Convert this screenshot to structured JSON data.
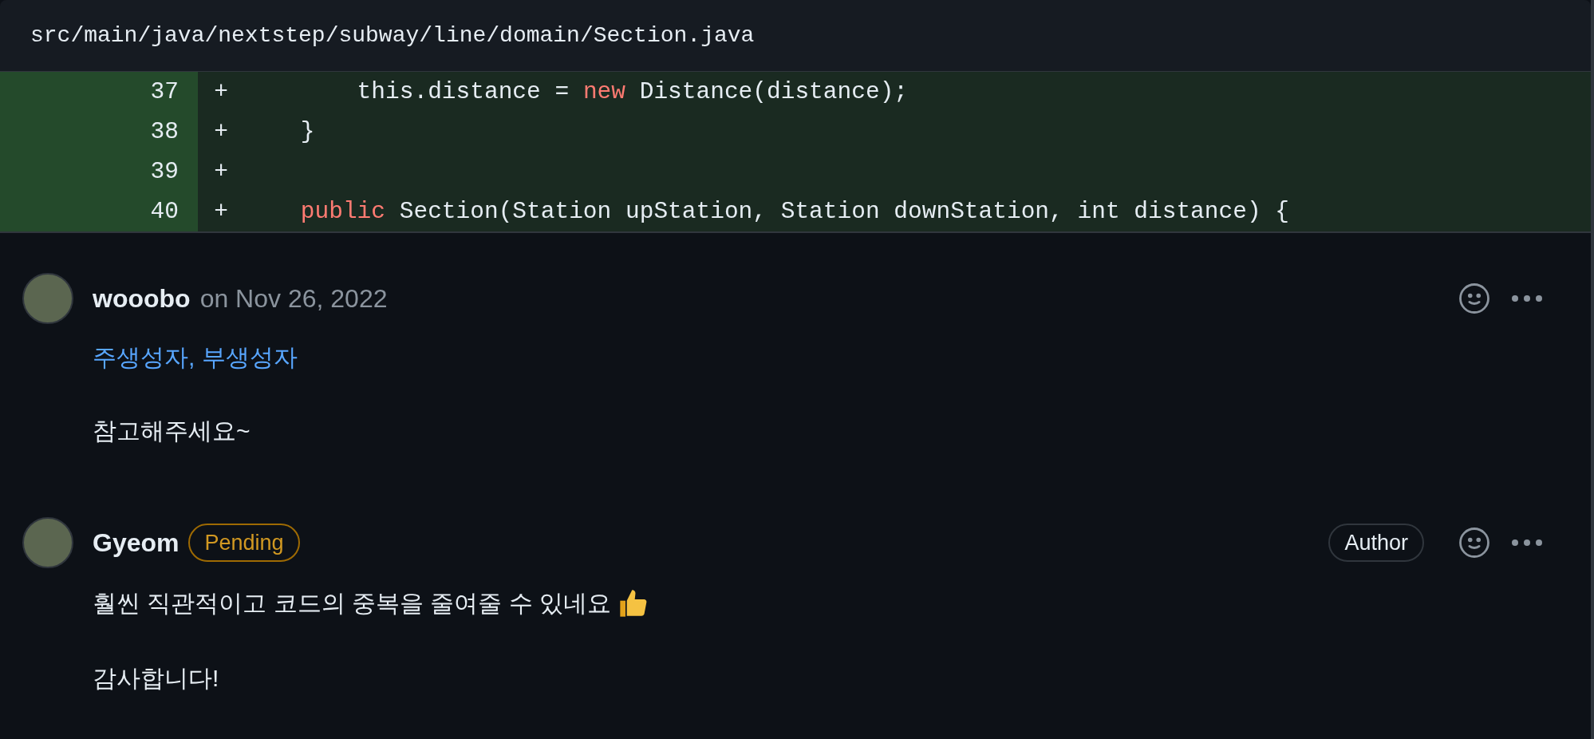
{
  "file_header": {
    "path": "src/main/java/nextstep/subway/line/domain/Section.java"
  },
  "diff_lines": [
    {
      "number": "37",
      "sign": "+",
      "tokens": [
        {
          "kind": "plain",
          "text": "        this.distance = "
        },
        {
          "kind": "keyword",
          "text": "new"
        },
        {
          "kind": "plain",
          "text": " Distance(distance);"
        }
      ]
    },
    {
      "number": "38",
      "sign": "+",
      "tokens": [
        {
          "kind": "plain",
          "text": "    }"
        }
      ]
    },
    {
      "number": "39",
      "sign": "+"
    },
    {
      "number": "40",
      "sign": "+",
      "tokens": [
        {
          "kind": "keyword",
          "text": "    public"
        },
        {
          "kind": "plain",
          "text": " Section(Station upStation, Station downStation, int distance) {"
        }
      ]
    }
  ],
  "comments": [
    {
      "author": "wooobo",
      "timestamp": "on Nov 26, 2022",
      "body": [
        {
          "kind": "link",
          "text": "주생성자, 부생성자"
        },
        {
          "kind": "text",
          "text": "참고해주세요~"
        }
      ]
    },
    {
      "author": "Gyeom",
      "status": "Pending",
      "role": "Author",
      "body": [
        {
          "kind": "text_emoji",
          "text": "훨씬 직관적이고 코드의 중복을 줄여줄 수 있네요"
        },
        {
          "kind": "text",
          "text": "감사합니다!"
        }
      ]
    }
  ]
}
